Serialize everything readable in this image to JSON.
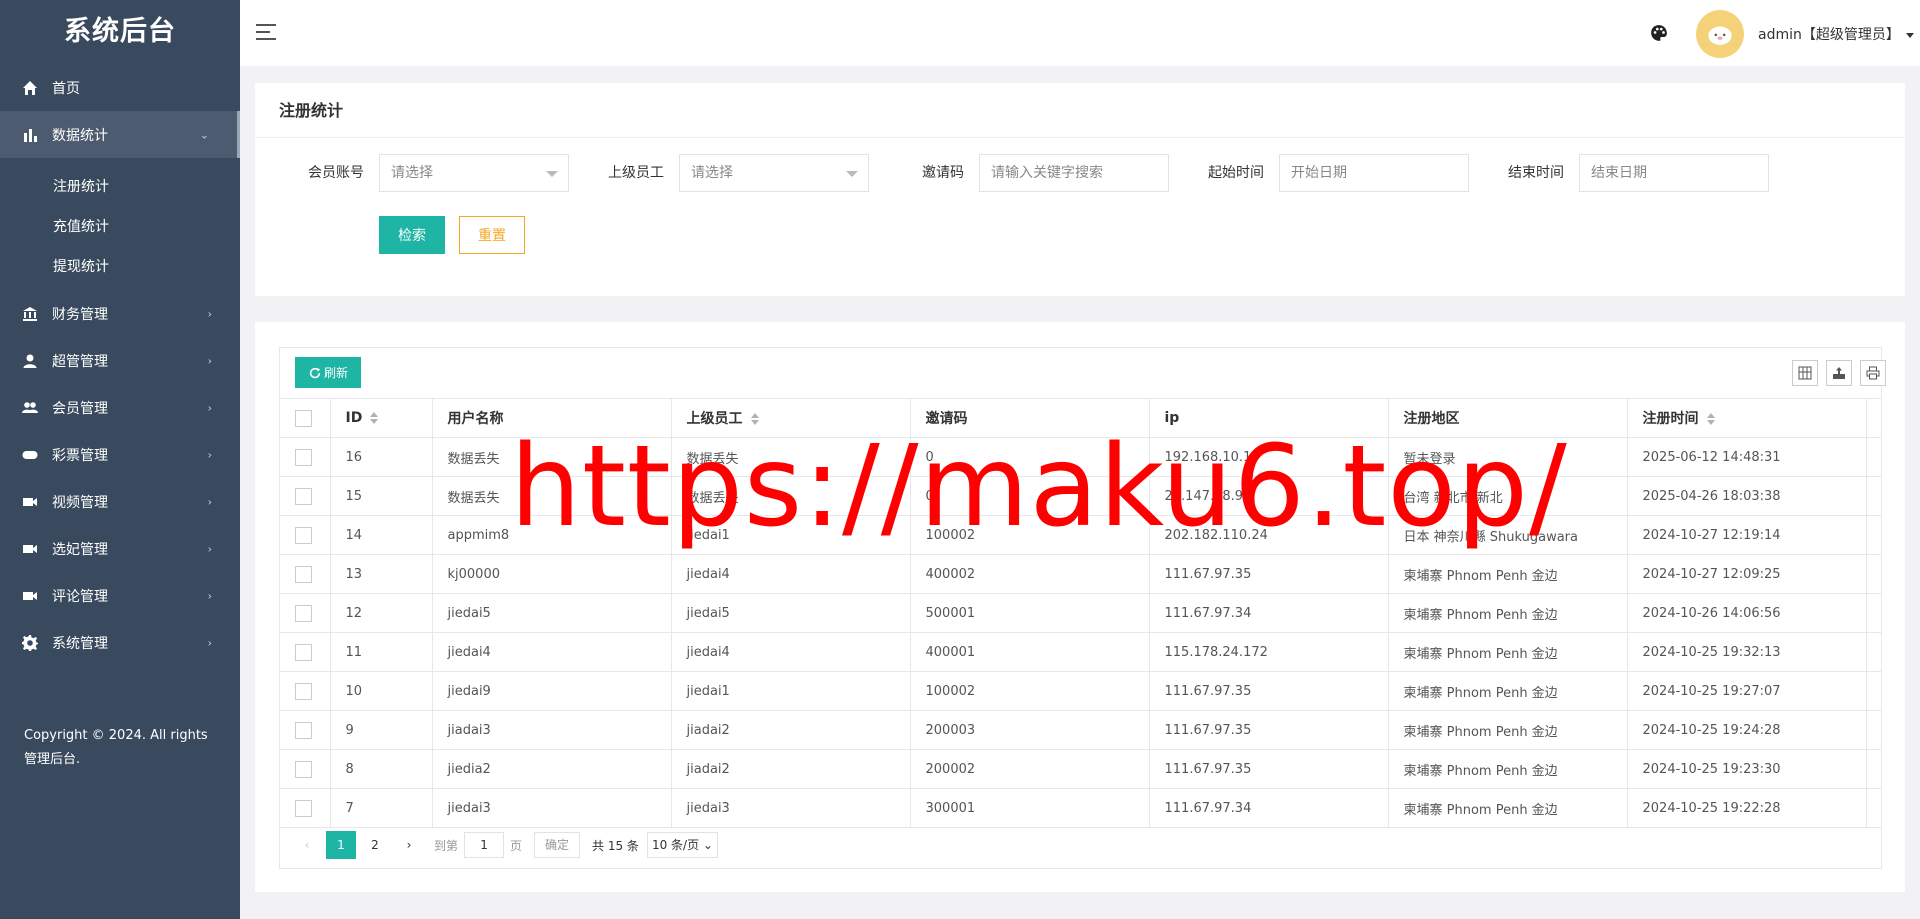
{
  "sidebar": {
    "brand": "系统后台",
    "items": [
      {
        "label": "首页",
        "icon": "home-icon"
      },
      {
        "label": "数据统计",
        "icon": "bar-chart-icon",
        "open": true,
        "children": [
          "注册统计",
          "充值统计",
          "提现统计"
        ]
      },
      {
        "label": "财务管理",
        "icon": "bank-icon"
      },
      {
        "label": "超管管理",
        "icon": "user-icon"
      },
      {
        "label": "会员管理",
        "icon": "users-icon"
      },
      {
        "label": "彩票管理",
        "icon": "gamepad-icon"
      },
      {
        "label": "视频管理",
        "icon": "video-icon"
      },
      {
        "label": "选妃管理",
        "icon": "video-icon"
      },
      {
        "label": "评论管理",
        "icon": "video-icon"
      },
      {
        "label": "系统管理",
        "icon": "gear-icon"
      }
    ],
    "copyright": "Copyright © 2024. All rights 管理后台."
  },
  "header": {
    "user": "admin【超级管理员】"
  },
  "search": {
    "title": "注册统计",
    "fields": [
      {
        "label": "会员账号",
        "placeholder": "请选择",
        "type": "select"
      },
      {
        "label": "上级员工",
        "placeholder": "请选择",
        "type": "select"
      },
      {
        "label": "邀请码",
        "placeholder": "请输入关键字搜索",
        "type": "input"
      },
      {
        "label": "起始时间",
        "placeholder": "开始日期",
        "type": "input"
      },
      {
        "label": "结束时间",
        "placeholder": "结束日期",
        "type": "input"
      }
    ],
    "search_label": "检索",
    "reset_label": "重置"
  },
  "table": {
    "refresh_label": "刷新",
    "columns": [
      "ID",
      "用户名称",
      "上级员工",
      "邀请码",
      "ip",
      "注册地区",
      "注册时间"
    ],
    "rows": [
      [
        "16",
        "数据丢失",
        "数据丢失",
        "0",
        "192.168.10.1",
        "暂未登录",
        "2025-06-12 14:48:31"
      ],
      [
        "15",
        "数据丢失",
        "数据丢失",
        "0",
        "27.147.88.90",
        "台湾 新北市 新北",
        "2025-04-26 18:03:38"
      ],
      [
        "14",
        "appmim8",
        "jiedai1",
        "100002",
        "202.182.110.24",
        "日本 神奈川縣 Shukugawara",
        "2024-10-27 12:19:14"
      ],
      [
        "13",
        "kj00000",
        "jiedai4",
        "400002",
        "111.67.97.35",
        "柬埔寨 Phnom Penh 金边",
        "2024-10-27 12:09:25"
      ],
      [
        "12",
        "jiedai5",
        "jiedai5",
        "500001",
        "111.67.97.34",
        "柬埔寨 Phnom Penh 金边",
        "2024-10-26 14:06:56"
      ],
      [
        "11",
        "jiedai4",
        "jiedai4",
        "400001",
        "115.178.24.172",
        "柬埔寨 Phnom Penh 金边",
        "2024-10-25 19:32:13"
      ],
      [
        "10",
        "jiedai9",
        "jiedai1",
        "100002",
        "111.67.97.35",
        "柬埔寨 Phnom Penh 金边",
        "2024-10-25 19:27:07"
      ],
      [
        "9",
        "jiadai3",
        "jiadai2",
        "200003",
        "111.67.97.35",
        "柬埔寨 Phnom Penh 金边",
        "2024-10-25 19:24:28"
      ],
      [
        "8",
        "jiedia2",
        "jiadai2",
        "200002",
        "111.67.97.35",
        "柬埔寨 Phnom Penh 金边",
        "2024-10-25 19:23:30"
      ],
      [
        "7",
        "jiedai3",
        "jiedai3",
        "300001",
        "111.67.97.34",
        "柬埔寨 Phnom Penh 金边",
        "2024-10-25 19:22:28"
      ]
    ]
  },
  "pagination": {
    "pages": [
      "1",
      "2"
    ],
    "current": "1",
    "goto_prefix": "到第",
    "goto_value": "1",
    "goto_suffix": "页",
    "confirm_label": "确定",
    "total": "共 15 条",
    "limit": "10 条/页"
  },
  "watermark": "https://maku6.top/",
  "colors": {
    "sidebar": "#3a4a5e",
    "accent": "#1fb5a5",
    "reset": "#f5a623",
    "watermark": "#ff0000"
  }
}
